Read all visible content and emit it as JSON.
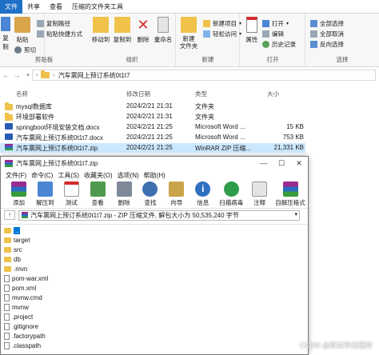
{
  "ribbon_tabs": [
    "文件",
    "共享",
    "查看",
    "压缩的文件夹工具"
  ],
  "ribbon": {
    "clipboard": {
      "copy_path": "复制路径",
      "paste_shortcut": "粘贴快捷方式",
      "cut": "剪切",
      "copy": "复制",
      "paste": "粘贴",
      "group": "剪贴板"
    },
    "organize": {
      "move_to": "移动到",
      "copy_to": "复制到",
      "delete": "删除",
      "rename": "重命名",
      "group": "组织"
    },
    "new": {
      "new_item": "新建项目",
      "easy_access": "轻松访问",
      "new_folder": "新建\n文件夹",
      "group": "新建"
    },
    "open": {
      "properties": "属性",
      "open": "打开",
      "edit": "编辑",
      "history": "历史记录",
      "group": "打开"
    },
    "select": {
      "select_all": "全部选择",
      "select_none": "全部取消",
      "invert": "反向选择",
      "group": "选择"
    }
  },
  "address": {
    "path": "汽车票网上预订系统0t1t7"
  },
  "columns": {
    "name": "名称",
    "modified": "修改日期",
    "type": "类型",
    "size": "大小"
  },
  "files": [
    {
      "name": "mysql数据库",
      "date": "2024/2/21 21:31",
      "type": "文件夹",
      "size": "",
      "icon": "folder-icon"
    },
    {
      "name": "环境部署软件",
      "date": "2024/2/21 21:31",
      "type": "文件夹",
      "size": "",
      "icon": "folder-icon"
    },
    {
      "name": "springboot环境安装文档.docx",
      "date": "2024/2/21 21:25",
      "type": "Microsoft Word ...",
      "size": "15 KB",
      "icon": "word-doc-icon"
    },
    {
      "name": "汽车票网上预订系统0t1t7.docx",
      "date": "2024/2/21 21:25",
      "type": "Microsoft Word ...",
      "size": "753 KB",
      "icon": "word-doc-icon"
    },
    {
      "name": "汽车票网上预订系统0t1t7.zip",
      "date": "2024/2/21 21:25",
      "type": "WinRAR ZIP 压缩...",
      "size": "21,331 KB",
      "icon": "winrar-archive-icon"
    }
  ],
  "rar": {
    "title": "汽车票网上预订系统0t1t7.zip",
    "menu": [
      "文件(F)",
      "命令(C)",
      "工具(S)",
      "收藏夹(O)",
      "选项(N)",
      "帮助(H)"
    ],
    "toolbar": [
      "添加",
      "解压到",
      "测试",
      "查看",
      "删除",
      "查找",
      "向导",
      "信息",
      "扫描病毒",
      "注释",
      "自解压格式"
    ],
    "path": "汽车票网上预订系统0t1t7.zip - ZIP 压缩文件, 解包大小为 50,535,240 字节",
    "tree": [
      {
        "name": "..",
        "kind": "folder"
      },
      {
        "name": "target",
        "kind": "folder"
      },
      {
        "name": "src",
        "kind": "folder"
      },
      {
        "name": "db",
        "kind": "folder"
      },
      {
        "name": ".mvn",
        "kind": "folder"
      },
      {
        "name": "pom-war.xml",
        "kind": "file"
      },
      {
        "name": "pom.xml",
        "kind": "file"
      },
      {
        "name": "mvnw.cmd",
        "kind": "file"
      },
      {
        "name": "mvnw",
        "kind": "file"
      },
      {
        "name": ".project",
        "kind": "file"
      },
      {
        "name": ".gitignore",
        "kind": "file"
      },
      {
        "name": ".factorypath",
        "kind": "file"
      },
      {
        "name": ".classpath",
        "kind": "file"
      }
    ]
  },
  "watermark": "CSDN @新达毕设程序"
}
